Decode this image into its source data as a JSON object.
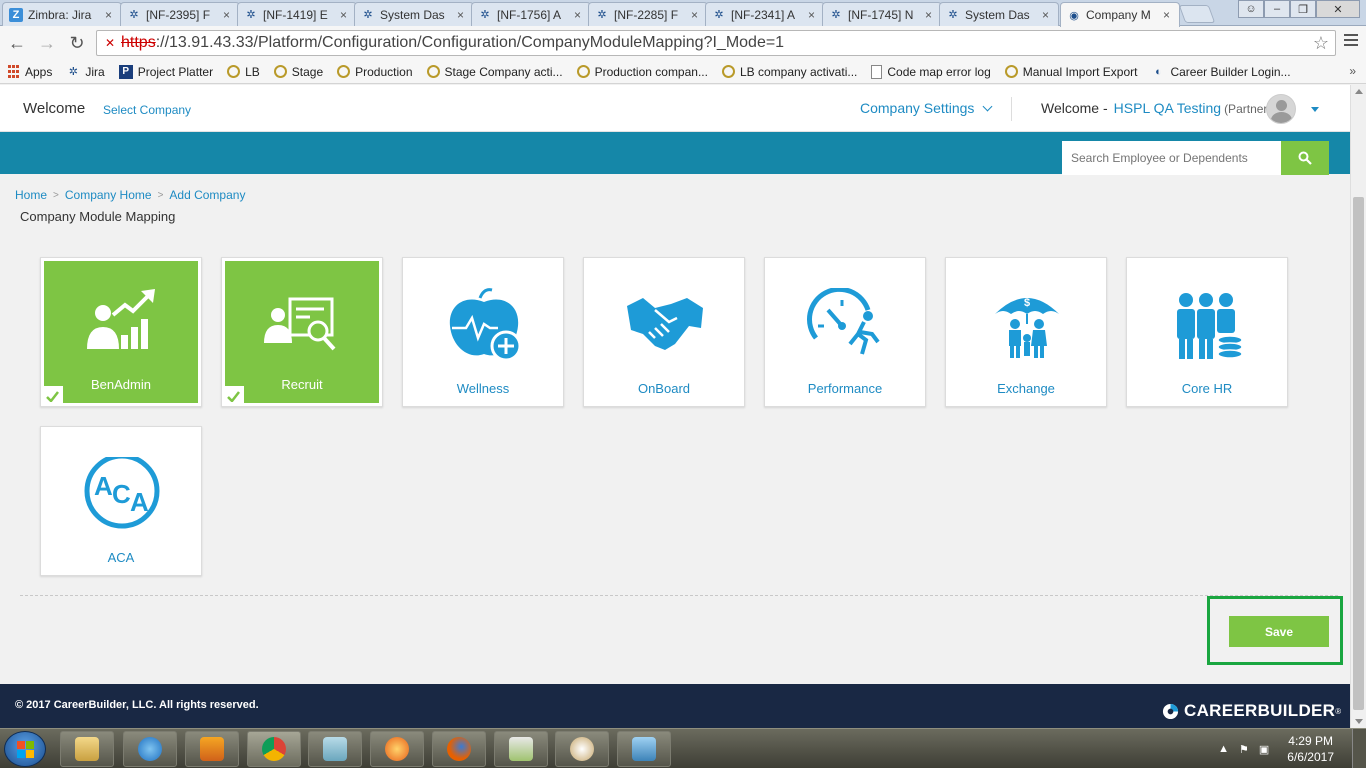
{
  "browser": {
    "tabs": [
      {
        "label": "Zimbra: Jira",
        "icon": "zimbra-icon"
      },
      {
        "label": "[NF-2395] F",
        "icon": "jira-icon"
      },
      {
        "label": "[NF-1419] E",
        "icon": "jira-icon"
      },
      {
        "label": "System Das",
        "icon": "jira-icon"
      },
      {
        "label": "[NF-1756] A",
        "icon": "jira-icon"
      },
      {
        "label": "[NF-2285] F",
        "icon": "jira-icon"
      },
      {
        "label": "[NF-2341] A",
        "icon": "jira-icon"
      },
      {
        "label": "[NF-1745] N",
        "icon": "jira-icon"
      },
      {
        "label": "System Das",
        "icon": "jira-icon"
      },
      {
        "label": "Company M",
        "icon": "page-icon",
        "active": true
      }
    ],
    "url_scheme": "https",
    "url_rest": "://13.91.43.33/Platform/Configuration/Configuration/CompanyModuleMapping?I_Mode=1",
    "bookmarks": [
      {
        "label": "Apps",
        "icon": "apps-icon"
      },
      {
        "label": "Jira",
        "icon": "jira-icon"
      },
      {
        "label": "Project Platter",
        "icon": "project-platter-icon"
      },
      {
        "label": "LB",
        "icon": "gear-icon"
      },
      {
        "label": "Stage",
        "icon": "gear-icon"
      },
      {
        "label": "Production",
        "icon": "gear-icon"
      },
      {
        "label": "Stage Company acti...",
        "icon": "gear-icon"
      },
      {
        "label": "Production compan...",
        "icon": "gear-icon"
      },
      {
        "label": "LB company activati...",
        "icon": "gear-icon"
      },
      {
        "label": "Code map error log",
        "icon": "document-icon"
      },
      {
        "label": "Manual Import Export",
        "icon": "gear-icon"
      },
      {
        "label": "Career Builder Login...",
        "icon": "careerbuilder-icon"
      }
    ],
    "bookmarks_more": "»"
  },
  "header": {
    "welcome": "Welcome",
    "select_company": "Select Company",
    "company_settings": "Company Settings",
    "user_welcome": "Welcome -",
    "user_name": "HSPL QA Testing",
    "user_role": "(Partner)"
  },
  "search": {
    "placeholder": "Search Employee or Dependents"
  },
  "breadcrumb": [
    "Home",
    "Company Home",
    "Add Company"
  ],
  "page_title": "Company Module Mapping",
  "modules": [
    {
      "label": "BenAdmin",
      "selected": true,
      "icon": "benadmin-icon"
    },
    {
      "label": "Recruit",
      "selected": true,
      "icon": "recruit-icon"
    },
    {
      "label": "Wellness",
      "selected": false,
      "icon": "wellness-icon"
    },
    {
      "label": "OnBoard",
      "selected": false,
      "icon": "handshake-icon"
    },
    {
      "label": "Performance",
      "selected": false,
      "icon": "performance-icon"
    },
    {
      "label": "Exchange",
      "selected": false,
      "icon": "exchange-icon"
    },
    {
      "label": "Core HR",
      "selected": false,
      "icon": "core-hr-icon"
    },
    {
      "label": "ACA",
      "selected": false,
      "icon": "aca-icon"
    }
  ],
  "save_label": "Save",
  "footer": {
    "copyright": "© 2017 CareerBuilder, LLC. All rights reserved.",
    "logo": "CAREERBUILDER",
    "logo_tm": "®"
  },
  "taskbar": {
    "time": "4:29 PM",
    "date": "6/6/2017"
  },
  "colors": {
    "accent_green": "#7ec544",
    "teal": "#1587a8",
    "link_blue": "#1e8bc3",
    "footer_navy": "#192844"
  }
}
